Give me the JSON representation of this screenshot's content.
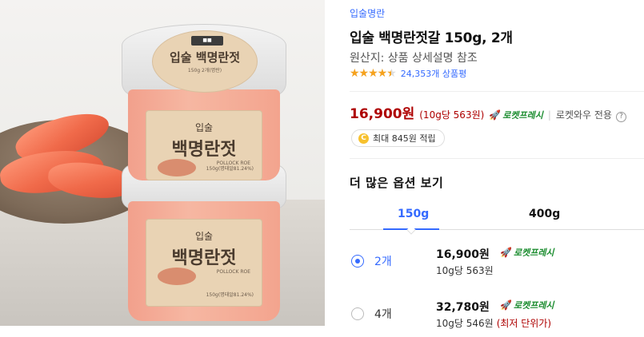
{
  "product_image": {
    "lid_label": "입술 백명란젓",
    "lid_net": "150g 2개(명란)",
    "jar_label_brand": "입술",
    "jar_label_title": "백명란젓",
    "jar_label_roe": "POLLOCK ROE",
    "jar_label_net": "150g(명태알81.24%)"
  },
  "brand": "입술명란",
  "title": "입술 백명란젓갈 150g, 2개",
  "origin": "원산지: 상품 상세설명 참조",
  "rating": {
    "stars": 4.5,
    "count_label": "24,353개 상품평"
  },
  "price": {
    "amount": "16,900원",
    "unit_price": "(10g당 563원)",
    "rocket_label": "로켓프레시",
    "rocket_wow": "로켓와우 전용",
    "help": "?"
  },
  "points": {
    "coin": "C",
    "label": "최대 845원 적립"
  },
  "options": {
    "heading": "더 많은 옵션 보기",
    "tabs": [
      {
        "label": "150g",
        "selected": true
      },
      {
        "label": "400g",
        "selected": false
      }
    ],
    "items": [
      {
        "qty": "2개",
        "price": "16,900원",
        "unit": "10g당 563원",
        "lowest": "",
        "rocket": "로켓프레시",
        "selected": true
      },
      {
        "qty": "4개",
        "price": "32,780원",
        "unit": "10g당 546원",
        "lowest": "(최저 단위가)",
        "rocket": "로켓프레시",
        "selected": false
      }
    ]
  },
  "colors": {
    "link_blue": "#346aff",
    "price_red": "#ae0000",
    "rocket_green": "#1a8c2e",
    "star": "#f6a21d"
  }
}
